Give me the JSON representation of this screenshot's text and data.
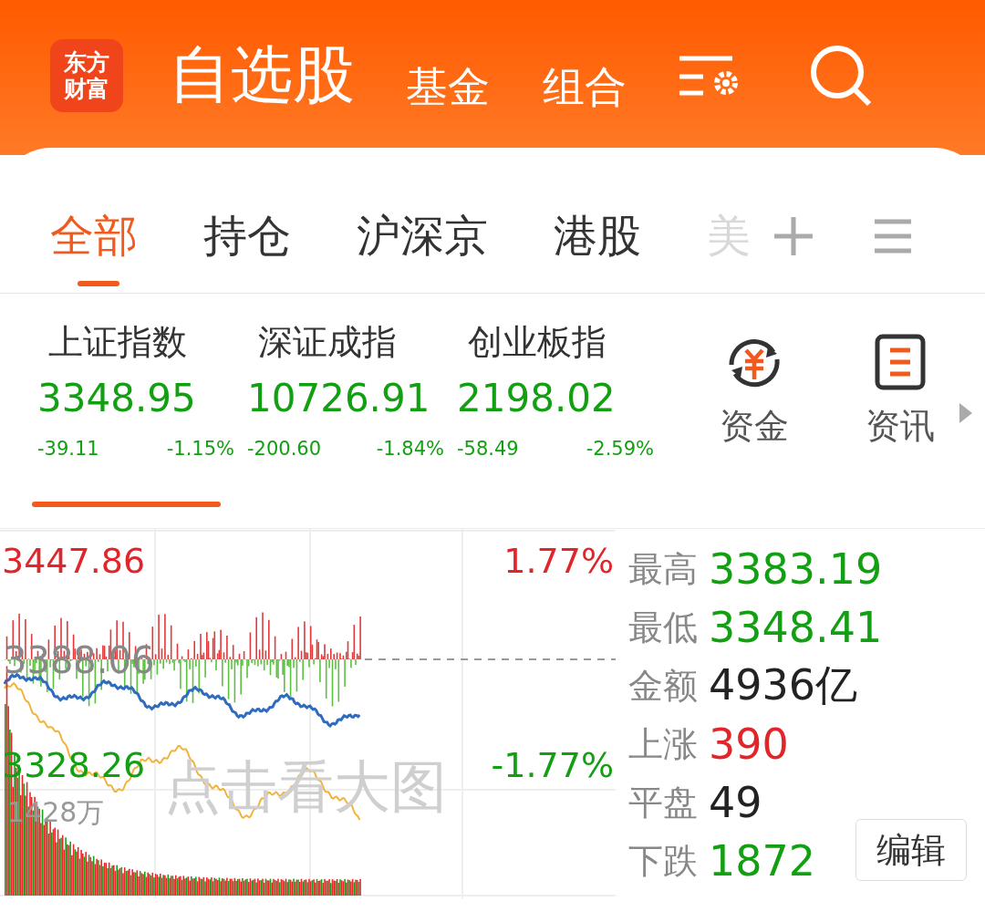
{
  "header": {
    "logo_lines": [
      "东方",
      "财富"
    ],
    "nav": [
      {
        "label": "自选股",
        "selected": true
      },
      {
        "label": "基金",
        "selected": false
      },
      {
        "label": "组合",
        "selected": false
      }
    ]
  },
  "tabs": [
    {
      "label": "全部",
      "selected": true
    },
    {
      "label": "持仓",
      "selected": false
    },
    {
      "label": "沪深京",
      "selected": false
    },
    {
      "label": "港股",
      "selected": false
    },
    {
      "label": "美",
      "selected": false,
      "faded": true
    }
  ],
  "indices": [
    {
      "name": "上证指数",
      "value": "3348.95",
      "change": "-39.11",
      "percent": "-1.15%",
      "color": "#12a012",
      "selected": true
    },
    {
      "name": "深证成指",
      "value": "10726.91",
      "change": "-200.60",
      "percent": "-1.84%",
      "color": "#12a012",
      "selected": false
    },
    {
      "name": "创业板指",
      "value": "2198.02",
      "change": "-58.49",
      "percent": "-2.59%",
      "color": "#12a012",
      "selected": false
    }
  ],
  "shortcuts": [
    {
      "label": "资金",
      "kind": "fund"
    },
    {
      "label": "资讯",
      "kind": "news"
    }
  ],
  "chart": {
    "high": "3447.86",
    "high_percent": "1.77%",
    "base": "3388.06",
    "low": "3328.26",
    "low_percent": "-1.77%",
    "volume": "1428万",
    "overlay": "点击看大图"
  },
  "stats": [
    {
      "label": "最高",
      "value": "3383.19",
      "color": "#12a012"
    },
    {
      "label": "最低",
      "value": "3348.41",
      "color": "#12a012"
    },
    {
      "label": "金额",
      "value": "4936亿",
      "color": "#222222"
    },
    {
      "label": "上涨",
      "value": "390",
      "color": "#e0262b"
    },
    {
      "label": "平盘",
      "value": "49",
      "color": "#222222"
    },
    {
      "label": "下跌",
      "value": "1872",
      "color": "#12a012"
    }
  ],
  "edit_button": "编辑"
}
